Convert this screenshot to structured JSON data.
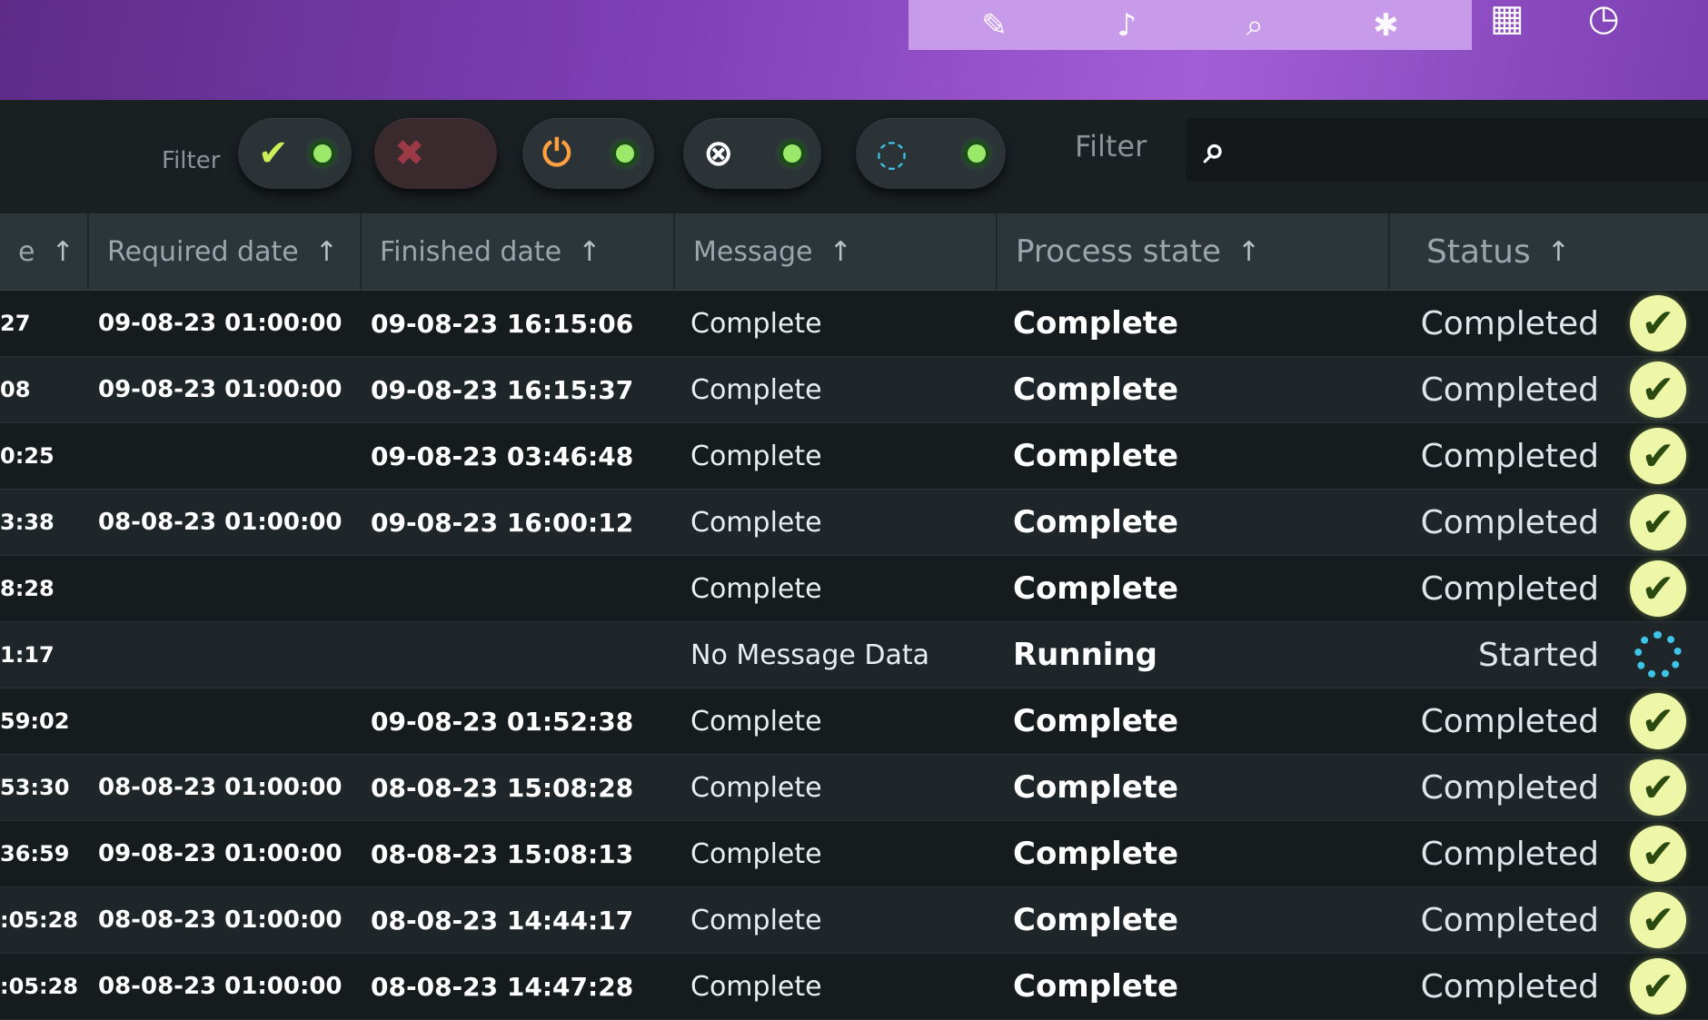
{
  "filters": {
    "left_label": "Filter",
    "search_label": "Filter",
    "search_placeholder": "",
    "buttons": [
      {
        "name": "filter-completed",
        "icon": "check-icon",
        "glyph": "✔",
        "color": "#c9ef5a",
        "indicator": true
      },
      {
        "name": "filter-failed",
        "icon": "error-icon",
        "glyph": "✖",
        "color": "#9b3a44",
        "indicator": false
      },
      {
        "name": "filter-power",
        "icon": "power-icon",
        "glyph": "⏻",
        "color": "#ffa040",
        "indicator": true
      },
      {
        "name": "filter-cancelled",
        "icon": "cancel-icon",
        "glyph": "⊗",
        "color": "#ffffff",
        "indicator": true
      },
      {
        "name": "filter-running",
        "icon": "spinner-icon",
        "glyph": "◌",
        "color": "#3ec4e6",
        "indicator": true
      }
    ]
  },
  "columns": {
    "first": "e",
    "required": "Required date",
    "finished": "Finished date",
    "message": "Message",
    "process": "Process state",
    "status": "Status",
    "sort_arrow": "↑"
  },
  "rows": [
    {
      "first": "27",
      "required": "09-08-23 01:00:00",
      "finished": "09-08-23 16:15:06",
      "message": "Complete",
      "process": "Complete",
      "status": "Completed",
      "icon": "check"
    },
    {
      "first": "08",
      "required": "09-08-23 01:00:00",
      "finished": "09-08-23 16:15:37",
      "message": "Complete",
      "process": "Complete",
      "status": "Completed",
      "icon": "check"
    },
    {
      "first": "0:25",
      "required": "",
      "finished": "09-08-23 03:46:48",
      "message": "Complete",
      "process": "Complete",
      "status": "Completed",
      "icon": "check"
    },
    {
      "first": "3:38",
      "required": "08-08-23 01:00:00",
      "finished": "09-08-23 16:00:12",
      "message": "Complete",
      "process": "Complete",
      "status": "Completed",
      "icon": "check"
    },
    {
      "first": "8:28",
      "required": "",
      "finished": "",
      "message": "Complete",
      "process": "Complete",
      "status": "Completed",
      "icon": "check"
    },
    {
      "first": "1:17",
      "required": "",
      "finished": "",
      "message": "No Message Data",
      "process": "Running",
      "status": "Started",
      "icon": "spinner"
    },
    {
      "first": "59:02",
      "required": "",
      "finished": "09-08-23 01:52:38",
      "message": "Complete",
      "process": "Complete",
      "status": "Completed",
      "icon": "check"
    },
    {
      "first": "53:30",
      "required": "08-08-23 01:00:00",
      "finished": "08-08-23 15:08:28",
      "message": "Complete",
      "process": "Complete",
      "status": "Completed",
      "icon": "check"
    },
    {
      "first": "36:59",
      "required": "09-08-23 01:00:00",
      "finished": "08-08-23 15:08:13",
      "message": "Complete",
      "process": "Complete",
      "status": "Completed",
      "icon": "check"
    },
    {
      "first": ":05:28",
      "required": "08-08-23 01:00:00",
      "finished": "08-08-23 14:44:17",
      "message": "Complete",
      "process": "Complete",
      "status": "Completed",
      "icon": "check"
    },
    {
      "first": ":05:28",
      "required": "08-08-23 01:00:00",
      "finished": "08-08-23 14:47:28",
      "message": "Complete",
      "process": "Complete",
      "status": "Completed",
      "icon": "check"
    }
  ]
}
